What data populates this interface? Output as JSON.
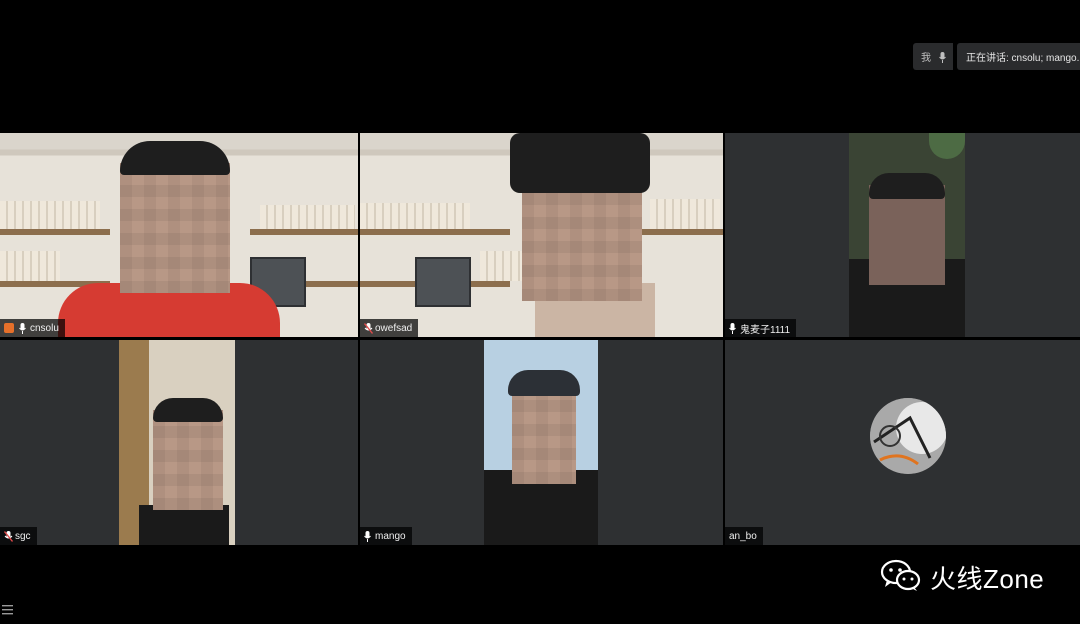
{
  "top_bar": {
    "me_label": "我",
    "speaking_text": "正在讲话: cnsolu; mango..."
  },
  "tiles": [
    {
      "name": "cnsolu"
    },
    {
      "name": "owefsad"
    },
    {
      "name": "鬼麦子1111"
    },
    {
      "name": "sgc"
    },
    {
      "name": "mango"
    },
    {
      "name": "an_bo"
    }
  ],
  "watermark": {
    "text": "火线Zone"
  },
  "colors": {
    "active_speaker_border": "#2bbf53",
    "tile_bg": "#2e3032",
    "host_badge": "#e6702a"
  },
  "icons": {
    "mic": "mic-icon",
    "muted_mic": "mic-muted-icon",
    "host": "host-badge-icon",
    "wechat": "wechat-icon",
    "list": "list-icon"
  }
}
